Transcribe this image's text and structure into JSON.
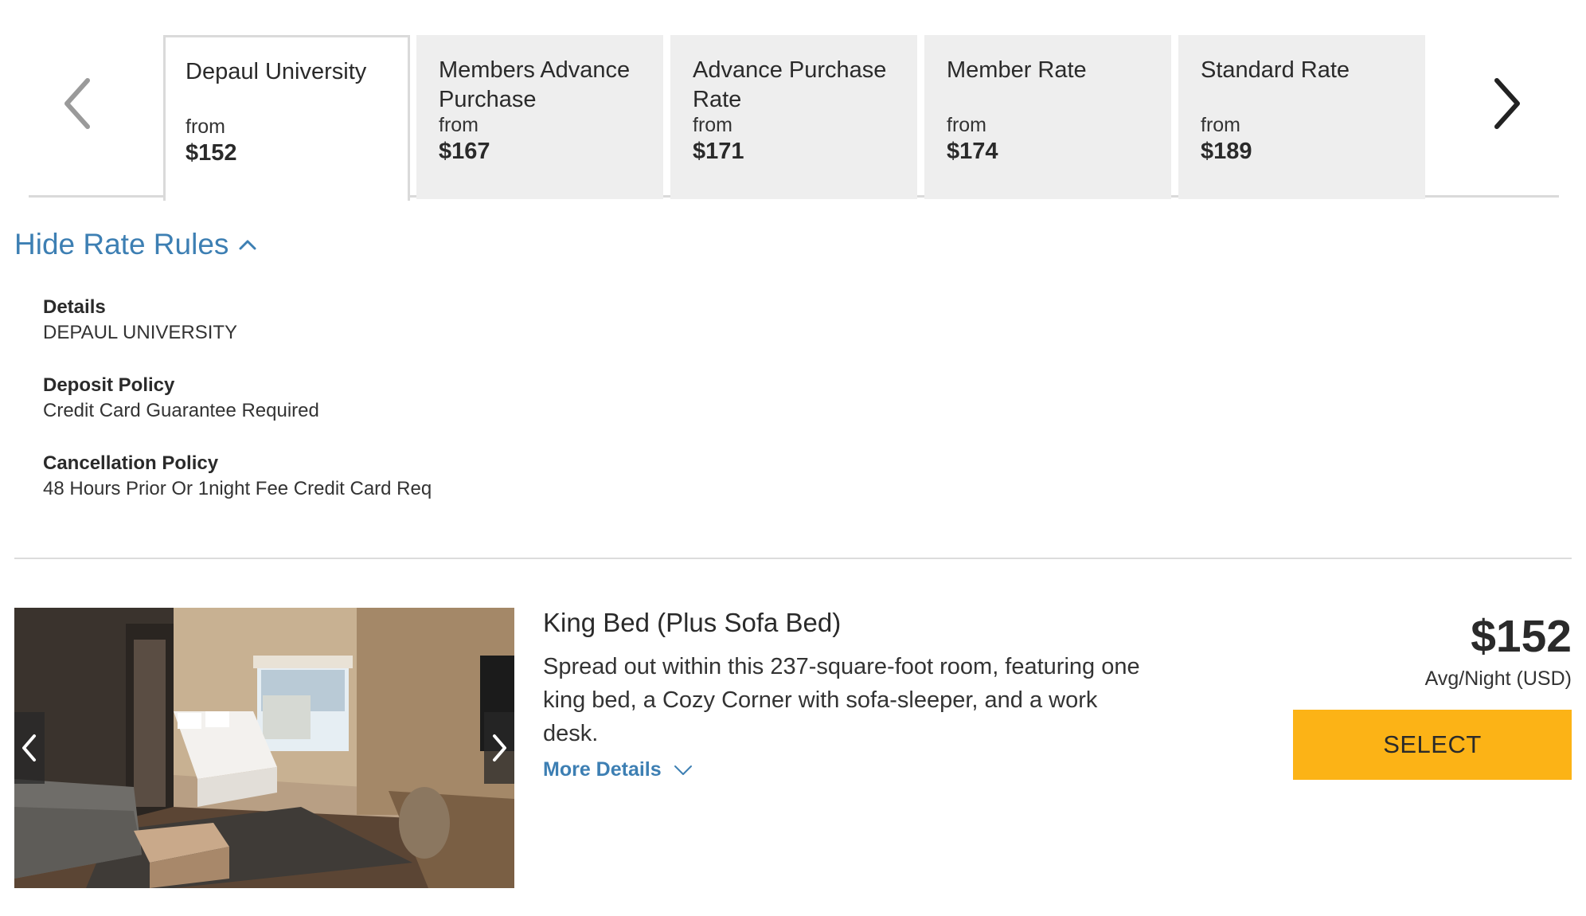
{
  "rate_tabs": [
    {
      "title": "Depaul University",
      "from_label": "from",
      "price": "$152",
      "active": true
    },
    {
      "title": "Members Advance Purchase",
      "from_label": "from",
      "price": "$167",
      "active": false
    },
    {
      "title": "Advance Purchase Rate",
      "from_label": "from",
      "price": "$171",
      "active": false
    },
    {
      "title": "Member Rate",
      "from_label": "from",
      "price": "$174",
      "active": false
    },
    {
      "title": "Standard Rate",
      "from_label": "from",
      "price": "$189",
      "active": false
    }
  ],
  "carousel": {
    "prev_icon": "chevron-left-icon",
    "next_icon": "chevron-right-icon"
  },
  "rate_rules": {
    "toggle_label": "Hide Rate Rules",
    "toggle_icon": "chevron-up-icon",
    "items": [
      {
        "label": "Details",
        "value": "DEPAUL UNIVERSITY"
      },
      {
        "label": "Deposit Policy",
        "value": "Credit Card Guarantee Required"
      },
      {
        "label": "Cancellation Policy",
        "value": "48 Hours Prior Or 1night Fee Credit Card Req"
      }
    ]
  },
  "room": {
    "title": "King Bed (Plus Sofa Bed)",
    "description": "Spread out within this 237-square-foot room, featuring one king bed, a Cozy Corner with sofa-sleeper, and a work desk.",
    "more_details_label": "More Details",
    "price": "$152",
    "price_note": "Avg/Night (USD)",
    "select_label": "SELECT"
  },
  "colors": {
    "link": "#3d7fb3",
    "select_button": "#fcb316",
    "inactive_tab": "#eeeeee",
    "border": "#dadada"
  }
}
